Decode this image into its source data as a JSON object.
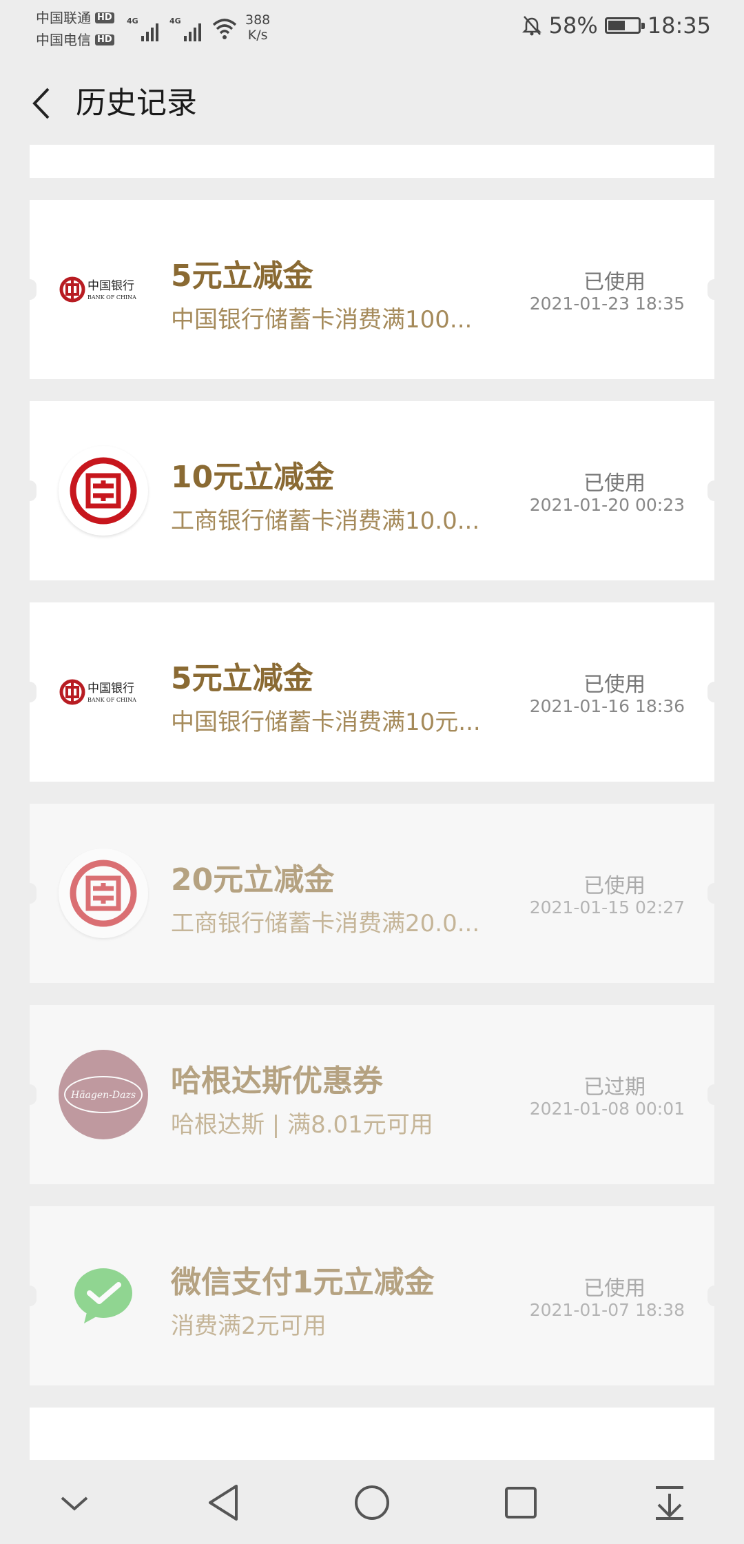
{
  "status": {
    "carrier1": "中国联通",
    "carrier2": "中国电信",
    "hd": "HD",
    "net": "4G",
    "speed_value": "388",
    "speed_unit": "K/s",
    "battery": "58%",
    "battery_level": 0.58,
    "time": "18:35"
  },
  "header": {
    "title": "历史记录"
  },
  "coupons": [
    {
      "title": "5元立减金",
      "sub": "中国银行储蓄卡消费满100...",
      "status": "已使用",
      "time": "2021-01-23 18:35",
      "logo": "bank-of-china-logo"
    },
    {
      "title": "10元立减金",
      "sub": "工商银行储蓄卡消费满10.0...",
      "status": "已使用",
      "time": "2021-01-20 00:23",
      "logo": "icbc-logo"
    },
    {
      "title": "5元立减金",
      "sub": "中国银行储蓄卡消费满10元...",
      "status": "已使用",
      "time": "2021-01-16 18:36",
      "logo": "bank-of-china-logo"
    },
    {
      "title": "20元立减金",
      "sub": "工商银行储蓄卡消费满20.0...",
      "status": "已使用",
      "time": "2021-01-15 02:27",
      "logo": "icbc-logo"
    },
    {
      "title": "哈根达斯优惠券",
      "sub": "哈根达斯 | 满8.01元可用",
      "status": "已过期",
      "time": "2021-01-08 00:01",
      "logo": "haagen-dazs-logo"
    },
    {
      "title": "微信支付1元立减金",
      "sub": "消费满2元可用",
      "status": "已使用",
      "time": "2021-01-07 18:38",
      "logo": "wechat-pay-logo"
    }
  ],
  "logos": {
    "boc_cn": "中国银行",
    "boc_en": "BANK OF CHINA",
    "hd_text": "Häagen-Dazs"
  },
  "colors": {
    "accent": "#8a6a33",
    "icbc": "#c7161d",
    "boc": "#b81c22",
    "wechat": "#4cbf4f",
    "hd": "#9a5c65"
  }
}
